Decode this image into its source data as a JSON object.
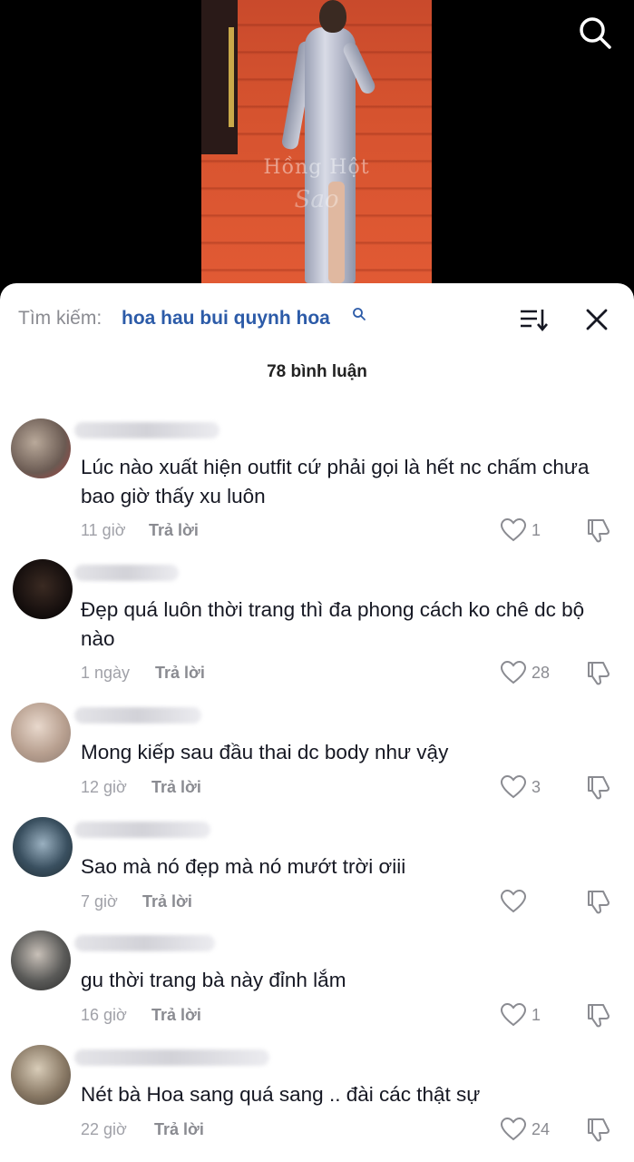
{
  "video": {
    "watermark_line1": "Hồng Hột",
    "watermark_line2": "Sao"
  },
  "icons": {
    "video_search": "search-icon",
    "search_mini": "search-icon",
    "sort": "sort-icon",
    "close": "close-icon",
    "like": "heart-icon",
    "dislike": "thumbs-down-icon"
  },
  "colors": {
    "query": "#2c5ba8",
    "muted": "#8a8b91",
    "text": "#161823"
  },
  "search": {
    "prefix": "Tìm kiếm:",
    "query": "hoa hau bui quynh hoa"
  },
  "comments_count": "78 bình luận",
  "reply_label": "Trả lời",
  "comments": [
    {
      "text": "Lúc nào xuất hiện outfit cứ phải gọi là hết nc chấm chưa bao giờ thấy xu luôn",
      "time": "11 giờ",
      "likes": "1"
    },
    {
      "text": "Đẹp quá luôn thời trang thì đa phong cách ko chê dc bộ nào",
      "time": "1 ngày",
      "likes": "28"
    },
    {
      "text": "Mong kiếp sau đầu thai dc body như vậy",
      "time": "12 giờ",
      "likes": "3"
    },
    {
      "text": "Sao mà nó đẹp mà nó mướt trời ơiii",
      "time": "7 giờ",
      "likes": ""
    },
    {
      "text": "gu thời trang bà này đỉnh lắm",
      "time": "16 giờ",
      "likes": "1"
    },
    {
      "text": "Nét bà Hoa sang quá sang .. đài các thật sự",
      "time": "22 giờ",
      "likes": "24"
    }
  ]
}
